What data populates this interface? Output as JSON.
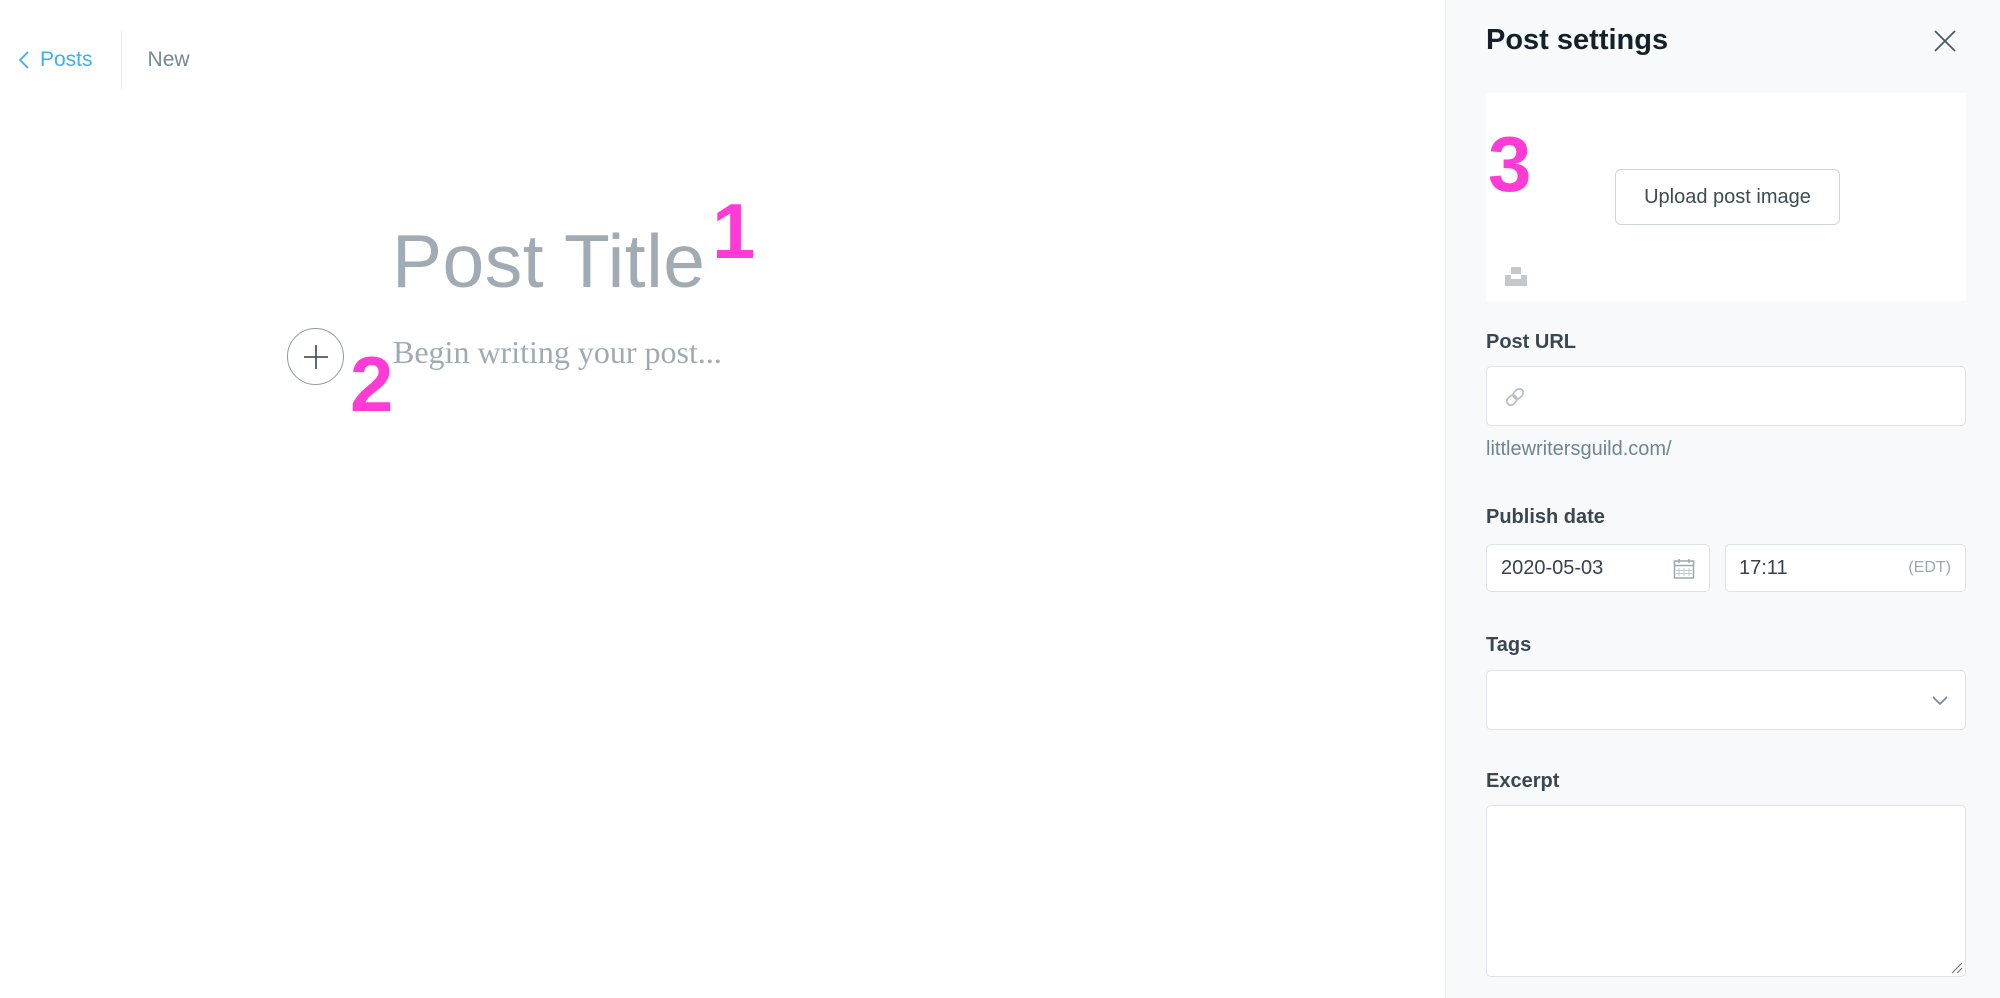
{
  "header": {
    "back_label": "Posts",
    "status": "New"
  },
  "editor": {
    "title_placeholder": "Post Title",
    "body_placeholder": "Begin writing your post..."
  },
  "markers": {
    "one": "1",
    "two": "2",
    "three": "3"
  },
  "settings": {
    "title": "Post settings",
    "upload_label": "Upload post image",
    "post_url_label": "Post URL",
    "post_url_value": "",
    "post_url_hint": "littlewritersguild.com/",
    "publish_date_label": "Publish date",
    "publish_date": "2020-05-03",
    "publish_time": "17:11",
    "timezone": "(EDT)",
    "tags_label": "Tags",
    "excerpt_label": "Excerpt"
  },
  "icons": {
    "back": "chevron-left-icon",
    "add": "plus-icon",
    "close": "close-icon",
    "unsplash": "unsplash-icon",
    "link": "link-icon",
    "calendar": "calendar-icon",
    "dropdown": "chevron-down-icon",
    "resize": "resize-handle-icon"
  },
  "colors": {
    "accent": "#3eb0ef",
    "marker": "#ff3bd5",
    "panel_bg": "#f8f9fa"
  }
}
